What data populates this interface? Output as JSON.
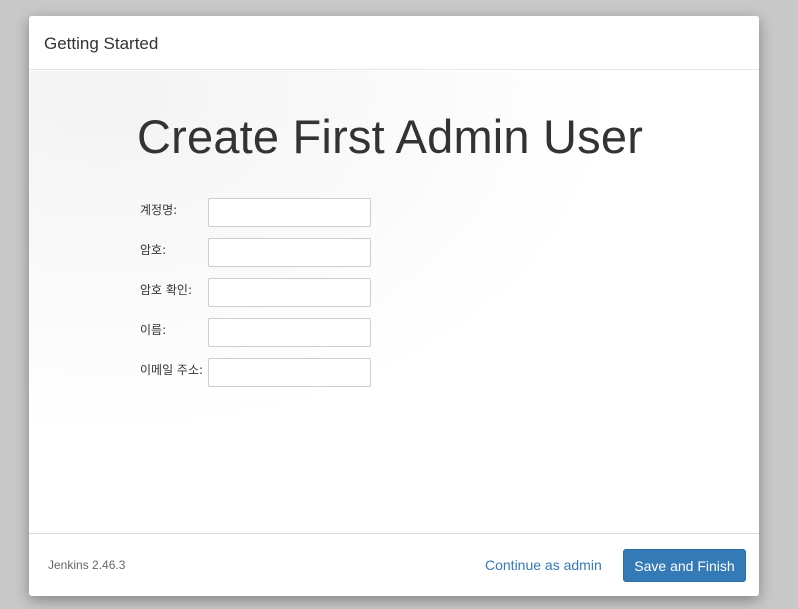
{
  "dialog": {
    "title": "Getting Started"
  },
  "main": {
    "heading": "Create First Admin User",
    "fields": [
      {
        "label": "계정명:",
        "value": ""
      },
      {
        "label": "암호:",
        "value": ""
      },
      {
        "label": "암호 확인:",
        "value": ""
      },
      {
        "label": "이름:",
        "value": ""
      },
      {
        "label": "이메일 주소:",
        "value": ""
      }
    ]
  },
  "footer": {
    "version": "Jenkins 2.46.3",
    "continue_label": "Continue as admin",
    "save_label": "Save and Finish"
  },
  "colors": {
    "primary": "#337ab7",
    "backdrop": "#c8c8c8"
  }
}
